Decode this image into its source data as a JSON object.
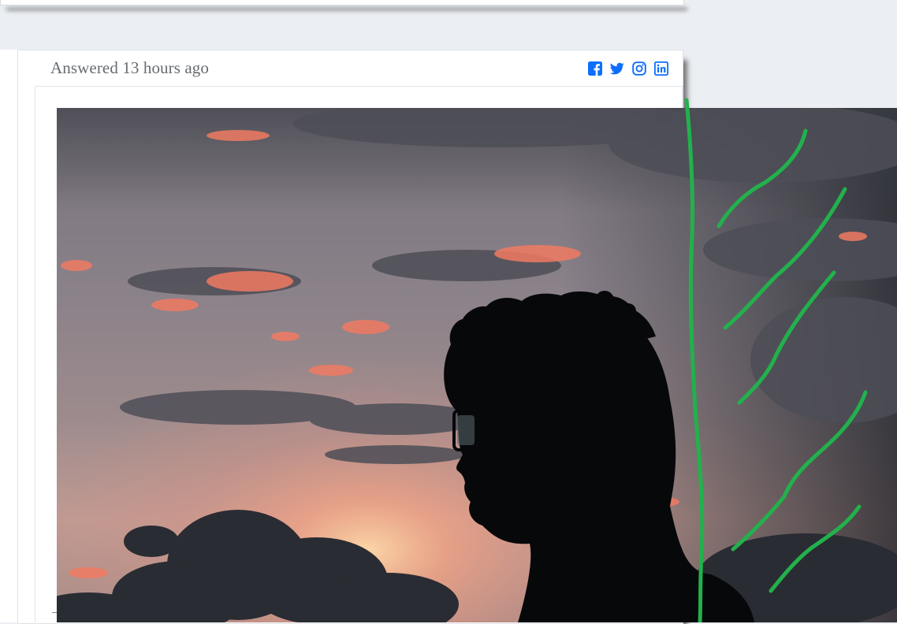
{
  "answer": {
    "meta": "Answered 13 hours ago"
  },
  "share_icons": [
    "facebook-icon",
    "twitter-icon",
    "instagram-icon",
    "linkedin-icon"
  ],
  "colors": {
    "accent": "#0d6efd",
    "page_bg": "#ebeef2",
    "annotation_green": "#22b14c"
  },
  "photo": {
    "subject": "silhouette-at-sunset"
  }
}
